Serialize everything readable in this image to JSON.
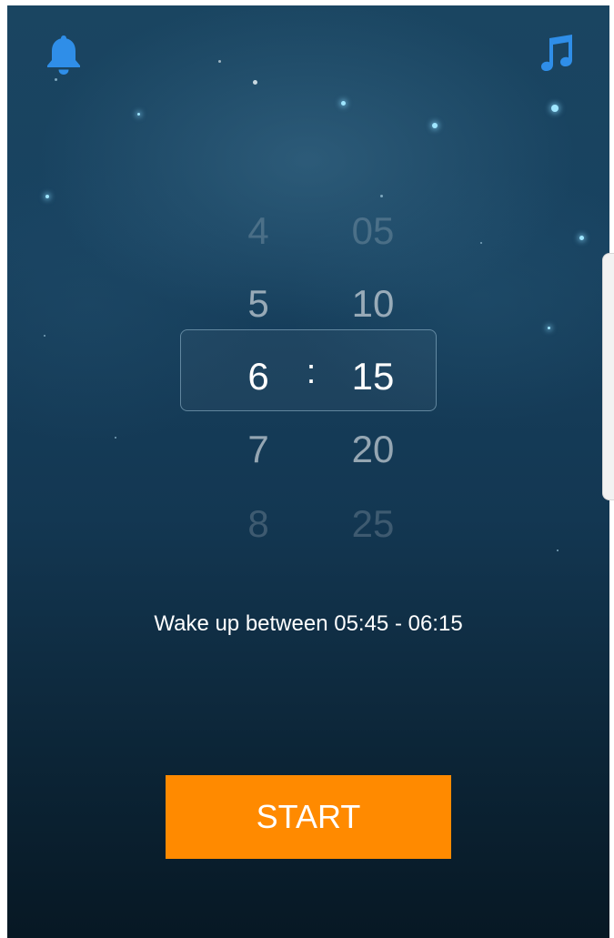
{
  "app": {
    "colors": {
      "accent_orange": "#ff8a00",
      "icon_blue": "#2f8ee8",
      "background_top": "#1a4561",
      "background_bottom": "#071824"
    }
  },
  "header": {
    "alarm_icon": "bell-icon",
    "sound_icon": "music-note-icon"
  },
  "picker": {
    "hours": [
      "4",
      "5",
      "6",
      "7",
      "8"
    ],
    "minutes": [
      "05",
      "10",
      "15",
      "20",
      "25"
    ],
    "separator": ":",
    "selected_hour": "6",
    "selected_minute": "15"
  },
  "wake_window": {
    "text": "Wake up between 05:45 - 06:15"
  },
  "actions": {
    "start_label": "START"
  }
}
